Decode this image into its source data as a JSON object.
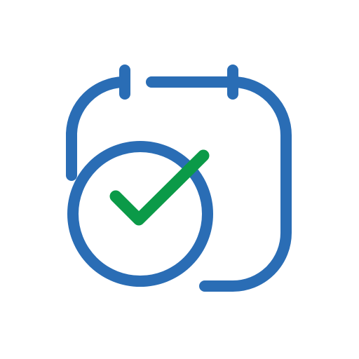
{
  "icon": {
    "name": "calendar-check-icon",
    "colors": {
      "outline": "#2a6db5",
      "check": "#0b9a48",
      "background": "#ffffff"
    }
  }
}
